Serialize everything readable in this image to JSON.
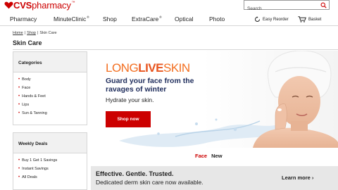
{
  "brand": {
    "logo_bold": "CVS",
    "logo_rest": "pharmacy",
    "tm": "™",
    "accent": "#cc0000"
  },
  "search": {
    "placeholder": "Search",
    "icon": "search-icon"
  },
  "nav": {
    "items": [
      {
        "label": "Pharmacy",
        "sup": ""
      },
      {
        "label": "MinuteClinic",
        "sup": "®"
      },
      {
        "label": "Shop",
        "sup": ""
      },
      {
        "label": "ExtraCare",
        "sup": "®"
      },
      {
        "label": "Optical",
        "sup": ""
      },
      {
        "label": "Photo",
        "sup": ""
      }
    ],
    "easy_reorder": "Easy Reorder",
    "basket": "Basket"
  },
  "breadcrumb": {
    "home": "Home",
    "shop": "Shop",
    "current": "Skin Care",
    "separator": "|"
  },
  "page_title": "Skin Care",
  "categories": {
    "title": "Categories",
    "items": [
      "Body",
      "Face",
      "Hands & Feet",
      "Lips",
      "Sun & Tanning"
    ]
  },
  "weekly_deals": {
    "title": "Weekly Deals",
    "items": [
      "Buy 1 Get 1 Savings",
      "Instant Savings",
      "All Deals"
    ]
  },
  "hero": {
    "title_part1": "LONG",
    "title_part2": "LIVE",
    "title_part3": "SKIN",
    "headline": "Guard your face from the ravages of winter",
    "subhead": "Hydrate your skin.",
    "button": "Shop now",
    "title_color": "#f36f21",
    "headline_color": "#1f2d5c"
  },
  "tabs": {
    "active": "Face",
    "inactive": "New"
  },
  "banner": {
    "headline": "Effective. Gentle. Trusted.",
    "subline": "Dedicated derm skin care now available.",
    "link": "Learn more ›"
  }
}
